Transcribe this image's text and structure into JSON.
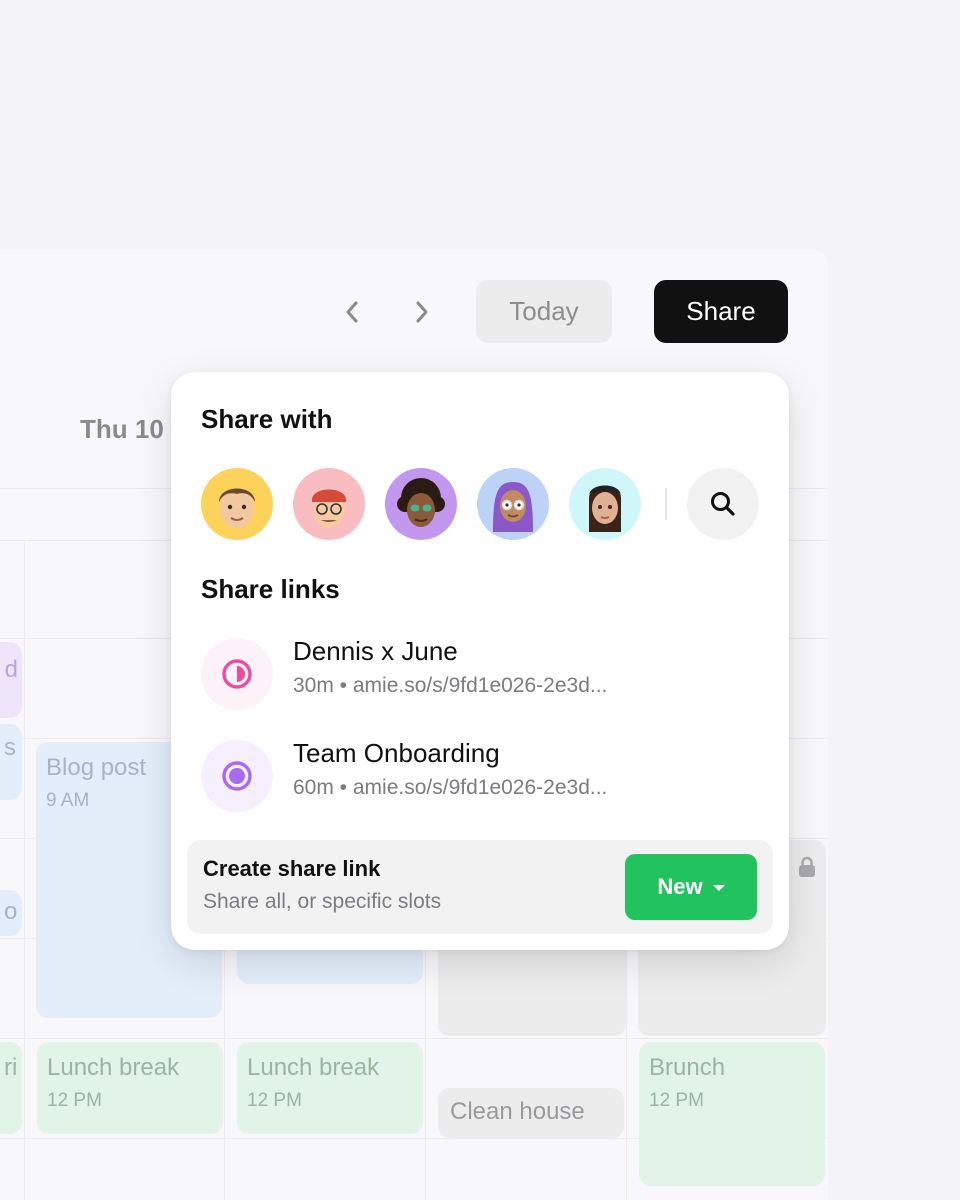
{
  "toolbar": {
    "prev_icon": "chevron-left-icon",
    "next_icon": "chevron-right-icon",
    "today_label": "Today",
    "share_label": "Share"
  },
  "calendar": {
    "day_header": "Thu 10",
    "events": {
      "blog_post": {
        "title": "Blog post",
        "time": "9 AM"
      },
      "lunch_1": {
        "title": "Lunch break",
        "time": "12 PM"
      },
      "lunch_2": {
        "title": "Lunch break",
        "time": "12 PM"
      },
      "clean_house": {
        "title": "Clean house"
      },
      "brunch": {
        "title": "Brunch",
        "time": "12 PM"
      },
      "partial_left_1": {
        "title": "d"
      },
      "partial_left_2": {
        "title": "s"
      },
      "partial_left_3": {
        "title": "o"
      },
      "partial_left_4": {
        "title": "ri"
      }
    }
  },
  "popover": {
    "share_with_title": "Share with",
    "share_links_title": "Share links",
    "avatars": [
      {
        "name": "avatar-1",
        "bg": "#fcd25a"
      },
      {
        "name": "avatar-2",
        "bg": "#f9bcc0"
      },
      {
        "name": "avatar-3",
        "bg": "#c298ef"
      },
      {
        "name": "avatar-4",
        "bg": "#bcd2f7"
      },
      {
        "name": "avatar-5",
        "bg": "#cff6f9"
      }
    ],
    "links": [
      {
        "name": "Dennis x June",
        "detail": "30m • amie.so/s/9fd1e026-2e3d...",
        "accent": "#ec4c9e"
      },
      {
        "name": "Team Onboarding",
        "detail": "60m • amie.so/s/9fd1e026-2e3d...",
        "accent": "#a86bf0"
      }
    ],
    "create": {
      "title": "Create share link",
      "subtitle": "Share all, or specific slots",
      "new_label": "New"
    }
  }
}
